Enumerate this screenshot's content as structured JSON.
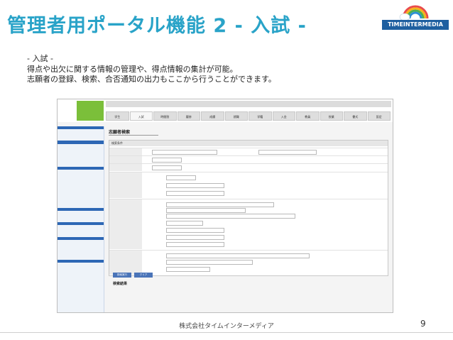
{
  "slide": {
    "title": "管理者用ポータル機能 2 - 入試 -",
    "logo_text": "TIMEINTERMEDIA",
    "description": [
      "- 入試 -",
      "得点や出欠に関する情報の管理や、得点情報の集計が可能。",
      "志願者の登録、検索、合否通知の出力もここから行うことができます。"
    ],
    "footer": "株式会社タイムインターメディア",
    "page_number": "9"
  },
  "app": {
    "nav_tabs": [
      "学生",
      "入試",
      "時間割",
      "履修",
      "成績",
      "就職",
      "学籍",
      "入金",
      "教員",
      "授業",
      "書式",
      "設定"
    ],
    "page_title": "志願者検索",
    "search_conditions_label": "検索条件",
    "search_button": "検索実行",
    "clear_button": "クリア",
    "results_label": "検索結果"
  }
}
